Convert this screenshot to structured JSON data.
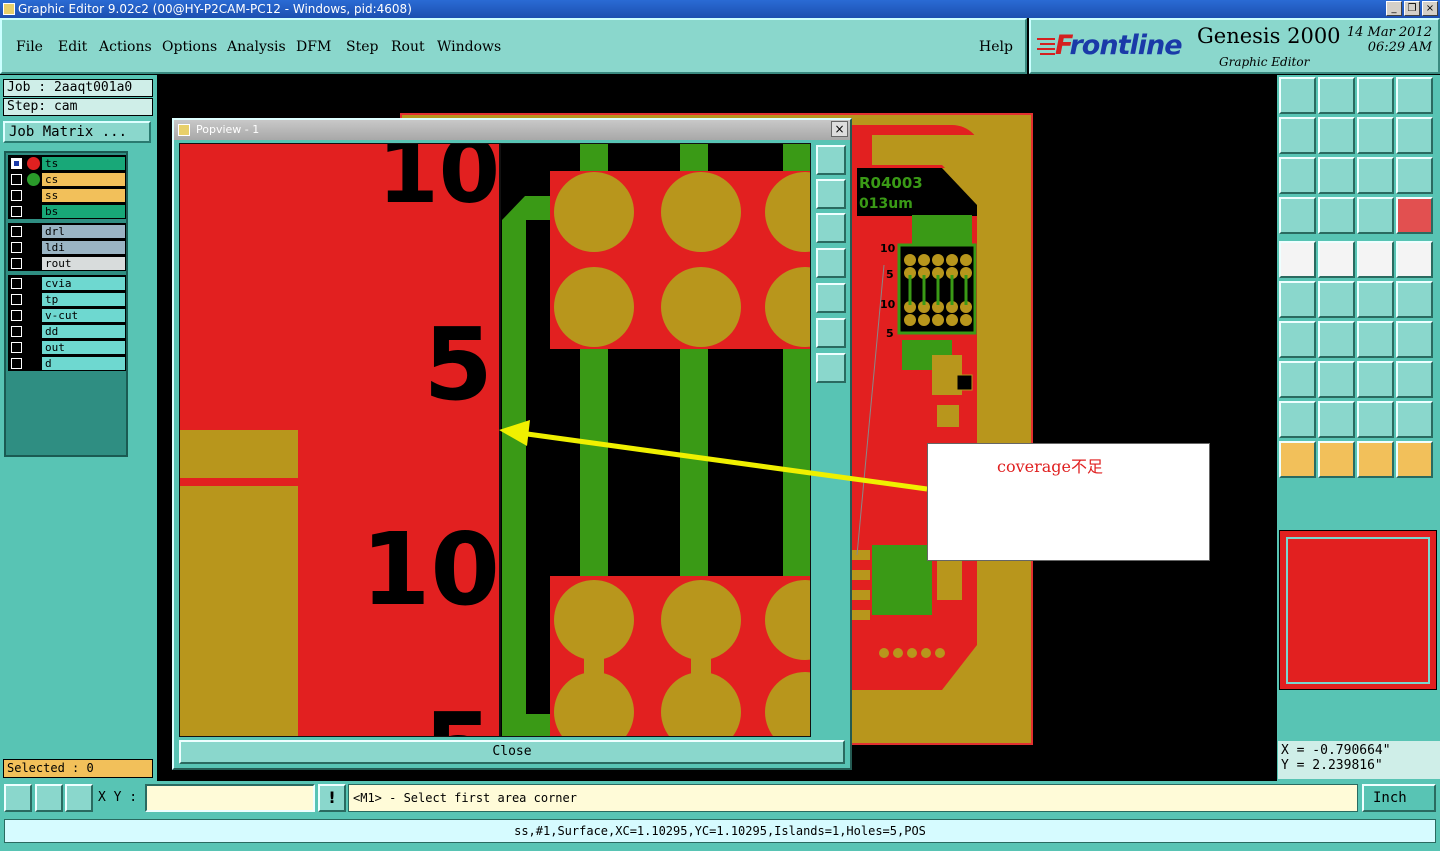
{
  "window": {
    "title": "Graphic Editor 9.02c2 (00@HY-P2CAM-PC12 - Windows, pid:4608)"
  },
  "menu": [
    {
      "label": "File"
    },
    {
      "label": "Edit"
    },
    {
      "label": "Actions"
    },
    {
      "label": "Options"
    },
    {
      "label": "Analysis"
    },
    {
      "label": "DFM"
    },
    {
      "label": "Step"
    },
    {
      "label": "Rout"
    },
    {
      "label": "Windows"
    }
  ],
  "help_label": "Help",
  "brand": {
    "logo_f": "F",
    "logo_rest": "rontline",
    "product": "Genesis 2000",
    "subtitle": "Graphic Editor",
    "date": "14 Mar 2012",
    "time": "06:29 AM"
  },
  "job": {
    "job_text": "Job : 2aaqt001a0",
    "step_text": "Step: cam",
    "matrix_label": "Job Matrix ..."
  },
  "layers": [
    {
      "name": "ts",
      "color": "#18a878",
      "dot": "#e02020",
      "checked": true
    },
    {
      "name": "cs",
      "color": "#f2c05a",
      "dot": "#2a9a2a",
      "checked": false
    },
    {
      "name": "ss",
      "color": "#f2c05a",
      "dot": "",
      "checked": false
    },
    {
      "name": "bs",
      "color": "#18a878",
      "dot": "",
      "checked": false
    },
    {
      "name": "drl",
      "color": "#9ab4c4",
      "dot": "",
      "checked": false
    },
    {
      "name": "ldi",
      "color": "#9ab4c4",
      "dot": "",
      "checked": false
    },
    {
      "name": "rout",
      "color": "#d8dcdc",
      "dot": "",
      "checked": false
    },
    {
      "name": "cvia",
      "color": "#6ed8d0",
      "dot": "",
      "checked": false
    },
    {
      "name": "tp",
      "color": "#6ed8d0",
      "dot": "",
      "checked": false
    },
    {
      "name": "v-cut",
      "color": "#6ed8d0",
      "dot": "",
      "checked": false
    },
    {
      "name": "dd",
      "color": "#6ed8d0",
      "dot": "",
      "checked": false
    },
    {
      "name": "out",
      "color": "#6ed8d0",
      "dot": "",
      "checked": false
    },
    {
      "name": "d",
      "color": "#6ed8d0",
      "dot": "",
      "checked": false
    }
  ],
  "selected_text": "Selected : 0",
  "popview": {
    "title": "Popview - 1",
    "close_label": "Close",
    "close_x": "×",
    "labels": [
      "10",
      "5",
      "10",
      "5"
    ]
  },
  "board_labels": {
    "part": "R04003",
    "thickness": "013um",
    "n10": "10",
    "n5": "5",
    "n10b": "10",
    "n5b": "5"
  },
  "annotation": {
    "text": "coverage不足"
  },
  "coords": {
    "x": "X = -0.790664\"",
    "y": "Y = 2.239816\""
  },
  "status": {
    "xy_label": "X Y :",
    "xy_value": "",
    "excl": "!",
    "prompt": "<M1> - Select first area corner",
    "units": "Inch"
  },
  "info": "ss,#1,Surface,XC=1.10295,YC=1.10295,Islands=1,Holes=5,POS",
  "window_buttons": [
    "_",
    "❐",
    "×"
  ],
  "colors": {
    "copper": "#b8961c",
    "red": "#e22020",
    "green": "#3a9a16",
    "teal": "#58c4b4",
    "yellow": "#f0f000"
  }
}
